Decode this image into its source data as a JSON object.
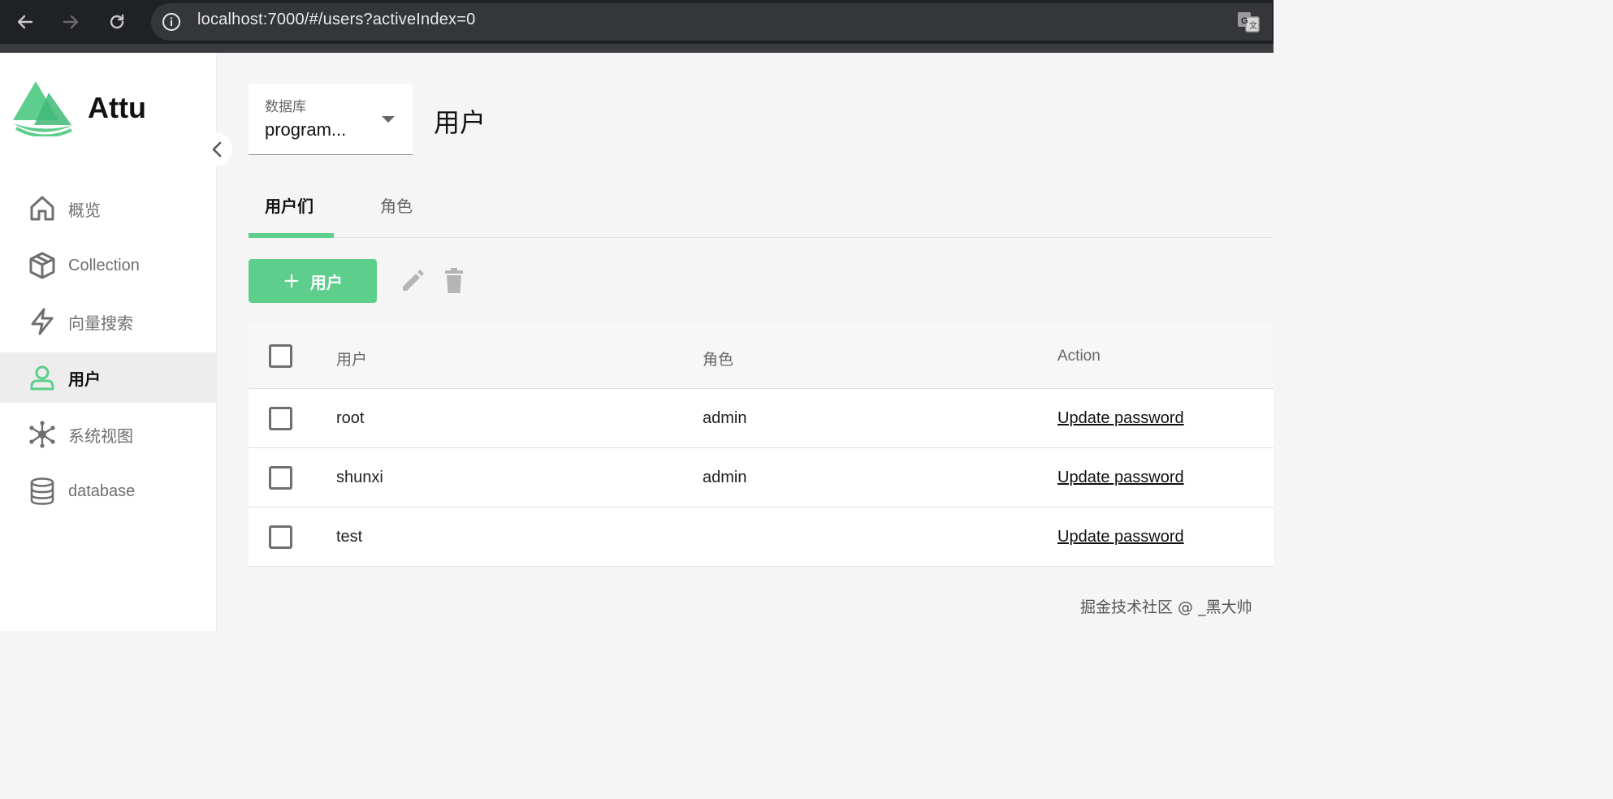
{
  "browser": {
    "url": "localhost:7000/#/users?activeIndex=0",
    "icons": {
      "back": "arrow-left-icon",
      "forward": "arrow-right-icon",
      "reload": "reload-icon",
      "info": "info-icon",
      "translate": "translate-icon"
    }
  },
  "app": {
    "name": "Attu",
    "logo_icon": "attu-logo",
    "brand_color": "#5dce8b"
  },
  "sidebar": {
    "items": [
      {
        "label": "概览",
        "icon": "home-icon",
        "active": false
      },
      {
        "label": "Collection",
        "icon": "cube-icon",
        "active": false
      },
      {
        "label": "向量搜索",
        "icon": "lightning-icon",
        "active": false
      },
      {
        "label": "用户",
        "icon": "user-icon",
        "active": true
      },
      {
        "label": "系统视图",
        "icon": "network-icon",
        "active": false
      },
      {
        "label": "database",
        "icon": "database-icon",
        "active": false
      }
    ]
  },
  "header": {
    "database_label": "数据库",
    "database_value": "program...",
    "page_title": "用户"
  },
  "tabs": [
    {
      "label": "用户们",
      "active": true
    },
    {
      "label": "角色",
      "active": false
    }
  ],
  "toolbar": {
    "add_label": "用户",
    "add_icon": "+"
  },
  "table": {
    "columns": [
      "用户",
      "角色",
      "Action"
    ],
    "rows": [
      {
        "user": "root",
        "role": "admin",
        "action": "Update password"
      },
      {
        "user": "shunxi",
        "role": "admin",
        "action": "Update password"
      },
      {
        "user": "test",
        "role": "",
        "action": "Update password"
      }
    ]
  },
  "watermark": "掘金技术社区 @ _黑大帅"
}
